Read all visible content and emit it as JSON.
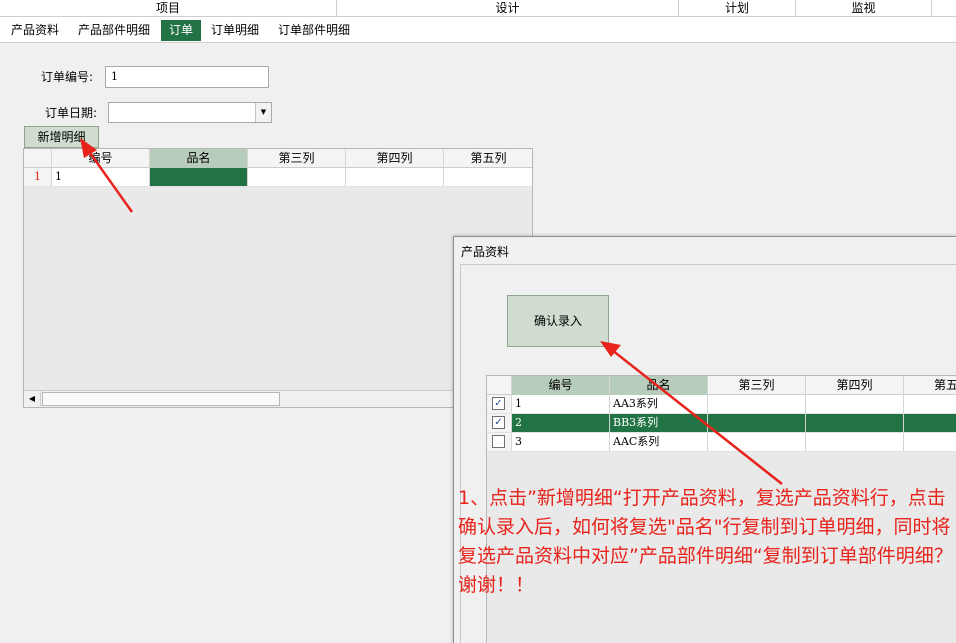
{
  "top_groups": [
    "项目",
    "设计",
    "计划",
    "监视"
  ],
  "tabs": [
    {
      "label": "产品资料"
    },
    {
      "label": "产品部件明细"
    },
    {
      "label": "订单"
    },
    {
      "label": "订单明细"
    },
    {
      "label": "订单部件明细"
    }
  ],
  "form": {
    "order_no_label": "订单编号:",
    "order_no_value": "1",
    "order_date_label": "订单日期:",
    "order_date_value": ""
  },
  "add_detail_button": "新增明细",
  "order_grid": {
    "columns": [
      "编号",
      "品名",
      "第三列",
      "第四列",
      "第五列"
    ],
    "rows": [
      {
        "row_no": "1",
        "cells": [
          "1",
          "",
          "",
          "",
          ""
        ]
      }
    ]
  },
  "popup": {
    "title": "产品资料",
    "confirm_button": "确认录入",
    "grid": {
      "columns": [
        "编号",
        "品名",
        "第三列",
        "第四列",
        "第五"
      ],
      "rows": [
        {
          "checked": true,
          "cells": [
            "1",
            "AA3系列",
            "",
            "",
            ""
          ],
          "highlight": false
        },
        {
          "checked": true,
          "cells": [
            "2",
            "BB3系列",
            "",
            "",
            ""
          ],
          "highlight": true
        },
        {
          "checked": false,
          "cells": [
            "3",
            "AAC系列",
            "",
            "",
            ""
          ],
          "highlight": false
        }
      ]
    }
  },
  "annotation": "1、点击”新增明细“打开产品资料，复选产品资料行，点击确认录入后，如何将复选\"品名\"行复制到订单明细，同时将复选产品资料中对应”产品部件明细“复制到订单部件明细？谢谢！！",
  "colors": {
    "accent": "#217346",
    "annotation": "#e8231b",
    "header_selected": "#b8ccbb"
  }
}
